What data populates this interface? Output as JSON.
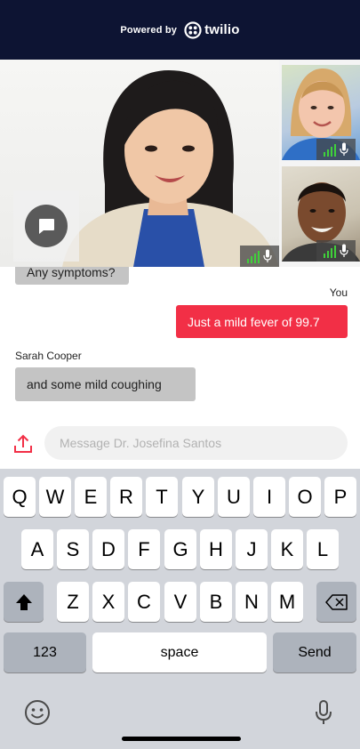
{
  "header": {
    "powered_by": "Powered by",
    "brand": "twilio"
  },
  "video": {
    "main_participant": "Dr. Josefina Santos",
    "thumbnails": [
      "participant-1",
      "participant-2"
    ]
  },
  "chat": {
    "messages": [
      {
        "sender": "",
        "text": "Any symptoms?",
        "side": "left"
      },
      {
        "sender": "You",
        "text": "Just a mild fever of 99.7",
        "side": "right"
      },
      {
        "sender": "Sarah Cooper",
        "text": "and some mild coughing",
        "side": "left"
      }
    ]
  },
  "composer": {
    "placeholder": "Message Dr. Josefina Santos"
  },
  "keyboard": {
    "row1": [
      "Q",
      "W",
      "E",
      "R",
      "T",
      "Y",
      "U",
      "I",
      "O",
      "P"
    ],
    "row2": [
      "A",
      "S",
      "D",
      "F",
      "G",
      "H",
      "J",
      "K",
      "L"
    ],
    "row3": [
      "Z",
      "X",
      "C",
      "V",
      "B",
      "N",
      "M"
    ],
    "numbers_label": "123",
    "space_label": "space",
    "send_label": "Send"
  },
  "colors": {
    "header_bg": "#0d1433",
    "accent_red": "#f22f46",
    "signal_green": "#3fd13a",
    "bubble_gray": "#c4c4c4"
  }
}
